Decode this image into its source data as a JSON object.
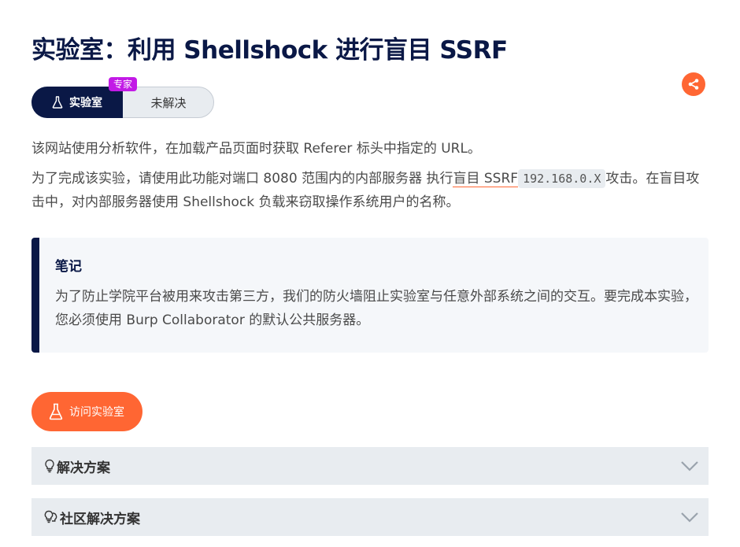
{
  "page": {
    "title": "实验室：利用 Shellshock 进行盲目 SSRF"
  },
  "status": {
    "level_badge": "专家",
    "lab_label": "实验室",
    "solve_state": "未解决"
  },
  "description": {
    "line1": "该网站使用分析软件，在加载产品页面时获取 Referer 标头中指定的 URL。",
    "line2_before": "为了完成该实验，请使用此功能对端口 8080 范围内的内部服务器 执行",
    "line2_link": "盲目 SSRF",
    "line2_code": "192.168.0.X",
    "line2_after": "攻击。在盲目攻击中，对内部服务器使用 Shellshock 负载来窃取操作系统用户的名称。"
  },
  "note": {
    "title": "笔记",
    "body": "为了防止学院平台被用来攻击第三方，我们的防火墙阻止实验室与任意外部系统之间的交互。要完成本实验，您必须使用 Burp Collaborator 的默认公共服务器。"
  },
  "actions": {
    "access_lab": "访问实验室"
  },
  "accordions": [
    {
      "label": "解决方案",
      "icon": "lightbulb-icon"
    },
    {
      "label": "社区解决方案",
      "icon": "lightbulbs-icon"
    }
  ],
  "colors": {
    "navy": "#0a1846",
    "orange": "#ff6633",
    "badge_purple": "#c21ae6",
    "panel_gray": "#e8ecf0"
  }
}
